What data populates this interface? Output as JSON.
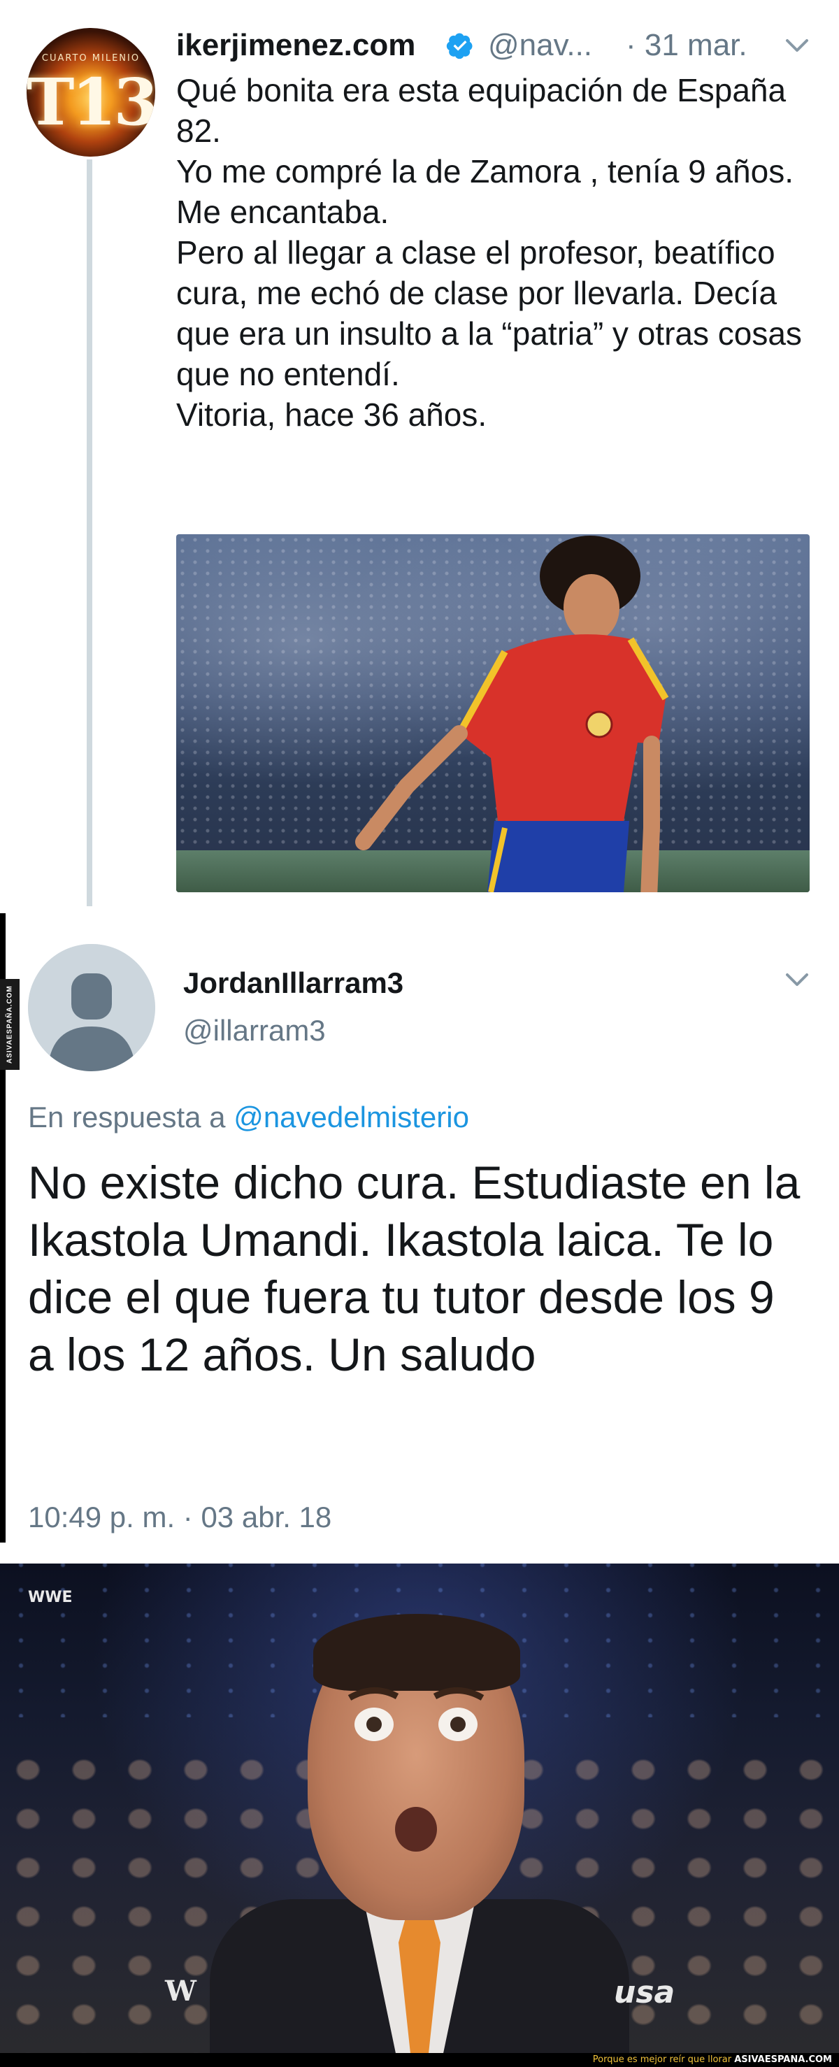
{
  "tweet1": {
    "avatar_text_ring": "CUARTO MILENIO",
    "avatar_text_big": "T13",
    "display_name": "ikerjimenez.com",
    "verified_icon": "verified-badge-icon",
    "handle": "@nav...",
    "date": "· 31 mar.",
    "lines": [
      "Qué bonita era esta equipación de España 82.",
      "Yo me compré la de Zamora , tenía 9 años.",
      "Me encantaba.",
      "Pero al llegar a clase el profesor, beatífico cura, me echó de clase por llevarla. Decía que era un insulto a la “patria” y otras cosas que no entendí.",
      "Vitoria, hace 36 años."
    ]
  },
  "tweet2": {
    "display_name": "JordanIllarram3",
    "handle": "@illarram3",
    "reply_prefix": "En respuesta a",
    "reply_mention": "@navedelmisterio",
    "text": "No existe dicho cura. Estudiaste en la Ikastola Umandi. Ikastola laica. Te lo dice el que fuera tu tutor desde los 9 a los 12 años. Un saludo",
    "timestamp": "10:49 p. m. · 03 abr. 18"
  },
  "reaction_image": {
    "logo_top_left": "WWE",
    "logo_bottom_left": "W",
    "logo_bottom_right": "usa"
  },
  "side_watermark": "ASIVAESPAÑA.COM",
  "footer": {
    "tagline": "Porque es mejor reír que llorar",
    "site": "ASIVAESPANA.COM"
  },
  "colors": {
    "link_blue": "#1b95e0",
    "muted_gray": "#657786",
    "text": "#14171a",
    "verified_blue": "#1da1f2",
    "thread_line": "#cfd9de"
  }
}
